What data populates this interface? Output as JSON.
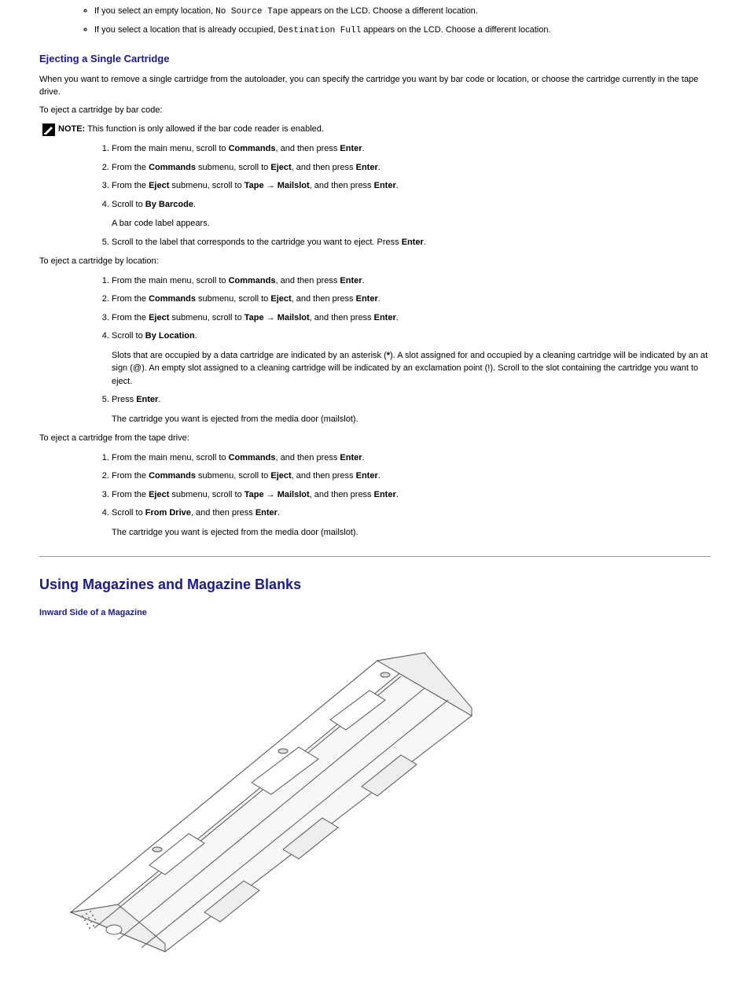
{
  "bullets": {
    "b1_pre": "If you select an empty location, ",
    "b1_code": "No Source Tape",
    "b1_post": " appears on the LCD. Choose a different location.",
    "b2_pre": "If you select a location that is already occupied, ",
    "b2_code": "Destination Full",
    "b2_post": " appears on the LCD. Choose a different location."
  },
  "eject": {
    "heading": "Ejecting a Single Cartridge",
    "intro": "When you want to remove a single cartridge from the autoloader, you can specify the cartridge you want by bar code or location, or choose the cartridge currently in the tape drive.",
    "by_barcode_intro": "To eject a cartridge by bar code:",
    "note_label": "NOTE:",
    "note_text": " This function is only allowed if the bar code reader is enabled.",
    "by_location_intro": "To eject a cartridge by location:",
    "from_drive_intro": "To eject a cartridge from the tape drive:",
    "steps_barcode": {
      "s1_pre": "From the main menu, scroll to ",
      "s1_b1": "Commands",
      "s1_mid": ", and then press ",
      "s1_b2": "Enter",
      "s1_post": ".",
      "s2_pre": "From the ",
      "s2_b1": "Commands",
      "s2_mid1": " submenu, scroll to ",
      "s2_b2": "Eject",
      "s2_mid2": ", and then press ",
      "s2_b3": "Enter",
      "s2_post": ".",
      "s3_pre": "From the ",
      "s3_b1": "Eject",
      "s3_mid1": " submenu, scroll to ",
      "s3_b2": "Tape → Mailslot",
      "s3_mid2": ", and then press ",
      "s3_b3": "Enter",
      "s3_post": ".",
      "s4_pre": "Scroll to ",
      "s4_b1": "By Barcode",
      "s4_post": ".",
      "s4_after": "A bar code label appears.",
      "s5_pre": "Scroll to the label that corresponds to the cartridge you want to eject. Press ",
      "s5_b1": "Enter",
      "s5_post": "."
    },
    "steps_location": {
      "s1_pre": "From the main menu, scroll to ",
      "s1_b1": "Commands",
      "s1_mid": ", and then press ",
      "s1_b2": "Enter",
      "s1_post": ".",
      "s2_pre": "From the ",
      "s2_b1": "Commands",
      "s2_mid1": " submenu, scroll to ",
      "s2_b2": "Eject",
      "s2_mid2": ", and then press ",
      "s2_b3": "Enter",
      "s2_post": ".",
      "s3_pre": "From the ",
      "s3_b1": "Eject",
      "s3_mid1": " submenu, scroll to ",
      "s3_b2": "Tape → Mailslot",
      "s3_mid2": ", and then press ",
      "s3_b3": "Enter",
      "s3_post": ".",
      "s4_pre": "Scroll to ",
      "s4_b1": "By Location",
      "s4_post": ".",
      "s4_after_pre": "Slots that are occupied by a data cartridge are indicated by an asterisk (",
      "s4_after_b": "*",
      "s4_after_post": "). A slot assigned for and occupied by a cleaning cartridge will be indicated by an at sign (@). An empty slot assigned to a cleaning cartridge will be indicated by an exclamation point (!). Scroll to the slot containing the cartridge you want to eject.",
      "s5_pre": "Press ",
      "s5_b1": "Enter",
      "s5_post": ".",
      "s5_after": "The cartridge you want is ejected from the media door (mailslot)."
    },
    "steps_drive": {
      "s1_pre": "From the main menu, scroll to ",
      "s1_b1": "Commands",
      "s1_mid": ", and then press ",
      "s1_b2": "Enter",
      "s1_post": ".",
      "s2_pre": "From the ",
      "s2_b1": "Commands",
      "s2_mid1": " submenu, scroll to ",
      "s2_b2": "Eject",
      "s2_mid2": ", and then press ",
      "s2_b3": "Enter",
      "s2_post": ".",
      "s3_pre": "From the ",
      "s3_b1": "Eject",
      "s3_mid1": " submenu, scroll to ",
      "s3_b2": "Tape → Mailslot",
      "s3_mid2": ", and then press ",
      "s3_b3": "Enter",
      "s3_post": ".",
      "s4_pre": "Scroll to ",
      "s4_b1": "From Drive",
      "s4_mid": ", and then press ",
      "s4_b2": "Enter",
      "s4_post": ".",
      "s4_after": "The cartridge you want is ejected from the media door (mailslot)."
    }
  },
  "magazines": {
    "heading": "Using Magazines and Magazine Blanks",
    "sub": "Inward Side of a Magazine"
  }
}
